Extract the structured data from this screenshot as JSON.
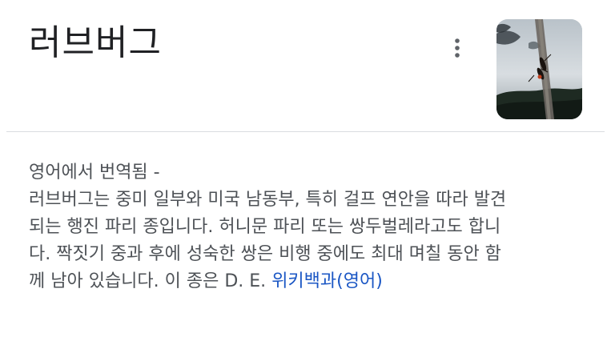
{
  "header": {
    "title": "러브버그",
    "more_icon": "more-vertical-icon",
    "thumbnail_alt": "러브버그"
  },
  "description": {
    "translated_label": "영어에서 번역됨 -",
    "lines": [
      "러브버그는 중미 일부와 미국 남동부, 특히 걸프 연안을 따라 발견",
      "되는 행진 파리 종입니다. 허니문 파리 또는 쌍두벌레라고도 합니",
      "다. 짝짓기 중과 후에 성숙한 쌍은 비행 중에도 최대 며칠 동안 함",
      "께 남아 있습니다. 이 종은 D. E."
    ],
    "source_link": "위키백과(영어)"
  },
  "colors": {
    "link": "#1a56c4",
    "body_text": "#4d5156",
    "title_text": "#202124",
    "divider": "#dadce0"
  }
}
